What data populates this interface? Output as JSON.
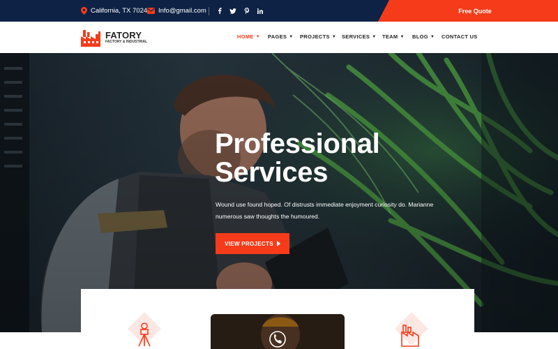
{
  "topbar": {
    "location": "California, TX 70240",
    "email": "Info@gmail.com",
    "quote_label": "Free Quote"
  },
  "header": {
    "logo_title": "FATORY",
    "logo_subtitle": "FACTORY & INDUSTRIAL",
    "nav": [
      {
        "label": "HOME",
        "caret": true,
        "active": true
      },
      {
        "label": "PAGES",
        "caret": true
      },
      {
        "label": "PROJECTS",
        "caret": true
      },
      {
        "label": "SERVICES",
        "caret": true
      },
      {
        "label": "TEAM",
        "caret": true
      },
      {
        "label": "BLOG",
        "caret": true
      },
      {
        "label": "CONTACT US",
        "caret": false
      }
    ]
  },
  "hero": {
    "title_line1": "Professional",
    "title_line2": "Services",
    "description": "Wound use found hoped. Of distrusts immediate enjoyment curiosity do. Marianne numerous saw thoughts the humoured.",
    "button_label": "VIEW PROJECTS"
  },
  "colors": {
    "accent": "#f53b1a",
    "navy": "#0d2244",
    "icon_bg": "#fde7e3"
  },
  "icons": [
    "map-pin-icon",
    "envelope-icon",
    "facebook-icon",
    "twitter-icon",
    "pinterest-icon",
    "linkedin-icon",
    "factory-icon",
    "surveyor-icon",
    "phone-icon",
    "plant-icon"
  ]
}
